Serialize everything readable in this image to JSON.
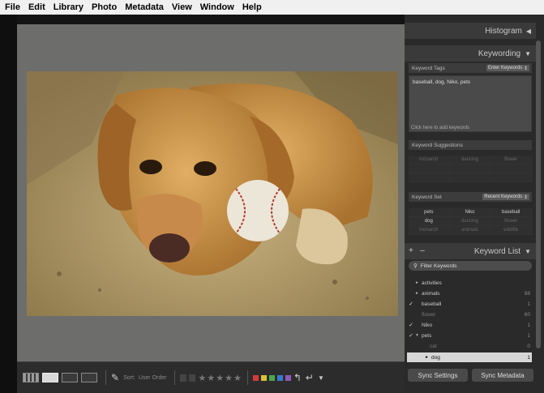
{
  "menu": [
    "File",
    "Edit",
    "Library",
    "Photo",
    "Metadata",
    "View",
    "Window",
    "Help"
  ],
  "panels": {
    "histogram": "Histogram",
    "keywording": "Keywording",
    "keyword_list": "Keyword List"
  },
  "keywording": {
    "tags_label": "Keyword Tags",
    "tags_dropdown": "Enter Keywords",
    "keywords_value": "baseball, dog, Niko, pets",
    "add_hint": "Click here to add keywords",
    "suggestions_label": "Keyword Suggestions",
    "suggestions": [
      "monarch",
      "dancing",
      "flower"
    ],
    "set_label": "Keyword Set",
    "set_dropdown": "Recent Keywords",
    "set_items": [
      "pets",
      "Niko",
      "baseball",
      "dog",
      "dancing",
      "flower",
      "monarch",
      "animals",
      "wildlife"
    ]
  },
  "keyword_list": {
    "plus": "+",
    "minus": "–",
    "filter_placeholder": "Filter Keywords",
    "items": [
      {
        "name": "activities",
        "count": "",
        "checked": "",
        "expander": "►"
      },
      {
        "name": "animals",
        "count": "98",
        "checked": "",
        "expander": "►"
      },
      {
        "name": "baseball",
        "count": "1",
        "checked": "✓",
        "expander": ""
      },
      {
        "name": "flower",
        "count": "60",
        "checked": "",
        "expander": ""
      },
      {
        "name": "Niko",
        "count": "1",
        "checked": "✓",
        "expander": ""
      },
      {
        "name": "pets",
        "count": "1",
        "checked": "✓",
        "expander": "▼"
      },
      {
        "name": "cat",
        "count": "0",
        "checked": "",
        "expander": ""
      },
      {
        "name": "dog",
        "count": "1",
        "checked": "☑",
        "expander": "►"
      }
    ]
  },
  "toolbar": {
    "sort_label": "Sort:",
    "sort_value": "User Order",
    "stars": [
      "★",
      "★",
      "★",
      "★",
      "★"
    ],
    "colors": [
      "#d23b3b",
      "#d8c23a",
      "#4aa84a",
      "#3a78d0",
      "#8a5ab8"
    ]
  },
  "buttons": {
    "sync_settings": "Sync Settings",
    "sync_metadata": "Sync Metadata"
  }
}
